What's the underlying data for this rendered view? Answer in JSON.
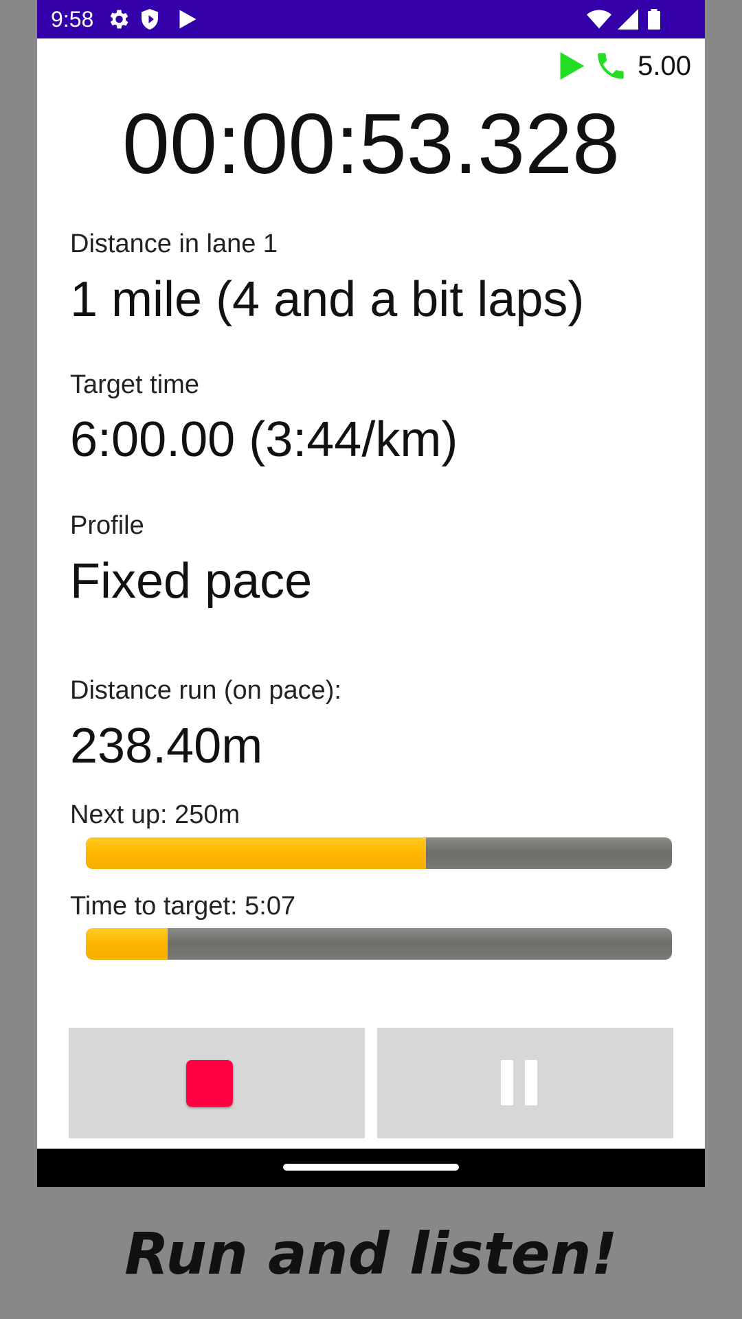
{
  "status_bar": {
    "time": "9:58",
    "icons": [
      "gear-icon",
      "shield-icon",
      "play-store-icon",
      "wifi-icon",
      "signal-icon",
      "battery-icon"
    ],
    "background": "#3300aa"
  },
  "indicators": {
    "play_icon": "play-icon",
    "phone_icon": "phone-icon",
    "speed": "5.00",
    "accent": "#22dd22"
  },
  "timer": {
    "elapsed": "00:00:53.328"
  },
  "fields": {
    "distance_label": "Distance in lane 1",
    "distance_value": "1 mile (4 and a bit laps)",
    "target_label": "Target time",
    "target_value": "6:00.00 (3:44/km)",
    "profile_label": "Profile",
    "profile_value": "Fixed pace",
    "run_label": "Distance run (on pace):",
    "run_value": "238.40m"
  },
  "progress": {
    "next_up_label": "Next up: 250m",
    "next_up_fraction": 0.58,
    "time_to_target_label": "Time to target: 5:07",
    "time_to_target_fraction": 0.14,
    "fill_color": "#ffb400",
    "track_color": "#777874"
  },
  "controls": {
    "stop_icon": "stop-icon",
    "stop_color": "#ff0040",
    "pause_icon": "pause-icon"
  },
  "caption": {
    "text": "Run and listen!"
  }
}
